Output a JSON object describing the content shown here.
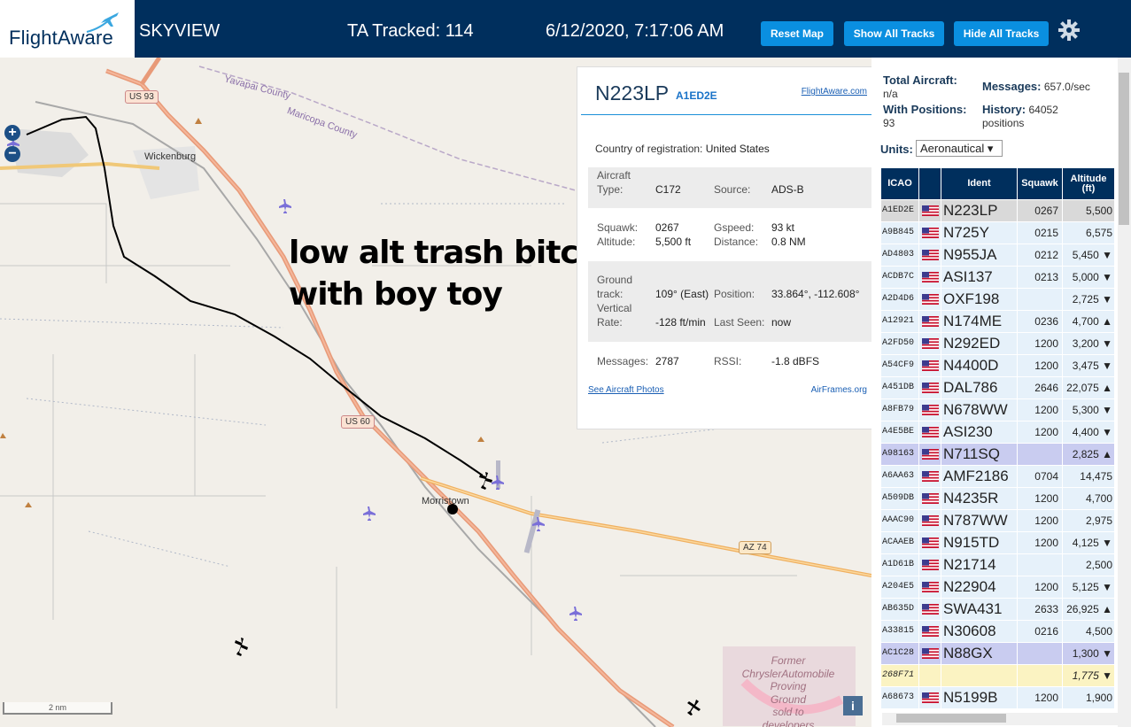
{
  "header": {
    "logo_text": "FlightAware",
    "app_title": "SKYVIEW",
    "tracked": "TA Tracked: 114",
    "datetime": "6/12/2020, 7:17:06 AM",
    "btn_reset": "Reset Map",
    "btn_show": "Show All Tracks",
    "btn_hide": "Hide All Tracks",
    "settings_icon": "gear-icon"
  },
  "map": {
    "zoom_in": "+",
    "zoom_out": "−",
    "annotation_line1": "low alt trash bitch",
    "annotation_line2": "with boy toy",
    "labels": {
      "yavapai": "Yavapai County",
      "maricopa": "Maricopa County",
      "wickenburg": "Wickenburg",
      "morristown": "Morristown",
      "us93": "US 93",
      "us60": "US 60",
      "az74": "AZ 74",
      "former1": "Former",
      "former2": "ChryslerAutomobile",
      "former3": "Proving",
      "former4": "Ground",
      "former5": "sold to",
      "former6": "developers"
    },
    "scale": "2 nm",
    "info": "i"
  },
  "detail": {
    "callsign": "N223LP",
    "hex": "A1ED2E",
    "fa_link": "FlightAware.com",
    "country_label": "Country of registration:",
    "country": "United States",
    "type_label1": "Aircraft",
    "type_label2": "Type:",
    "type": "C172",
    "source_label": "Source:",
    "source": "ADS-B",
    "squawk_label": "Squawk:",
    "squawk": "0267",
    "gspeed_label": "Gspeed:",
    "gspeed": "93 kt",
    "altitude_label": "Altitude:",
    "altitude": "5,500 ft",
    "distance_label": "Distance:",
    "distance": "0.8 NM",
    "track_label1": "Ground",
    "track_label2": "track:",
    "track": "109° (East)",
    "position_label": "Position:",
    "position": "33.864°, -112.608°",
    "vrate_label1": "Vertical",
    "vrate_label2": "Rate:",
    "vrate": "-128 ft/min",
    "lastseen_label": "Last Seen:",
    "lastseen": "now",
    "messages_label": "Messages:",
    "messages": "2787",
    "rssi_label": "RSSI:",
    "rssi": "-1.8 dBFS",
    "photos_link": "See Aircraft Photos",
    "airframes_link": "AirFrames.org"
  },
  "sidebar": {
    "total_label": "Total Aircraft:",
    "total": "n/a",
    "messages_label": "Messages:",
    "messages": "657.0/sec",
    "withpos_label": "With Positions:",
    "withpos": "93",
    "history_label": "History:",
    "history": "64052",
    "history_unit": "positions",
    "units_label": "Units:",
    "units_value": "Aeronautical ▾",
    "columns": {
      "icao": "ICAO",
      "flag": "",
      "ident": "Ident",
      "squawk": "Squawk",
      "alt1": "Altitude",
      "alt2": "(ft)"
    },
    "rows": [
      {
        "icao": "A1ED2E",
        "ident": "N223LP",
        "squawk": "0267",
        "alt": "5,500",
        "style": "selected"
      },
      {
        "icao": "A9B845",
        "ident": "N725Y",
        "squawk": "0215",
        "alt": "6,575",
        "style": "normal"
      },
      {
        "icao": "AD4803",
        "ident": "N955JA",
        "squawk": "0212",
        "alt": "5,450 ▼",
        "style": "normal"
      },
      {
        "icao": "ACDB7C",
        "ident": "ASI137",
        "squawk": "0213",
        "alt": "5,000 ▼",
        "style": "normal"
      },
      {
        "icao": "A2D4D6",
        "ident": "OXF198",
        "squawk": "",
        "alt": "2,725 ▼",
        "style": "normal"
      },
      {
        "icao": "A12921",
        "ident": "N174ME",
        "squawk": "0236",
        "alt": "4,700 ▲",
        "style": "normal"
      },
      {
        "icao": "A2FD50",
        "ident": "N292ED",
        "squawk": "1200",
        "alt": "3,200 ▼",
        "style": "normal"
      },
      {
        "icao": "A54CF9",
        "ident": "N4400D",
        "squawk": "1200",
        "alt": "3,475 ▼",
        "style": "normal"
      },
      {
        "icao": "A451DB",
        "ident": "DAL786",
        "squawk": "2646",
        "alt": "22,075 ▲",
        "style": "normal"
      },
      {
        "icao": "A8FB79",
        "ident": "N678WW",
        "squawk": "1200",
        "alt": "5,300 ▼",
        "style": "normal"
      },
      {
        "icao": "A4E5BE",
        "ident": "ASI230",
        "squawk": "1200",
        "alt": "4,400 ▼",
        "style": "normal"
      },
      {
        "icao": "A98163",
        "ident": "N711SQ",
        "squawk": "",
        "alt": "2,825 ▲",
        "style": "purple"
      },
      {
        "icao": "A6AA63",
        "ident": "AMF2186",
        "squawk": "0704",
        "alt": "14,475",
        "style": "normal"
      },
      {
        "icao": "A509DB",
        "ident": "N4235R",
        "squawk": "1200",
        "alt": "4,700",
        "style": "normal"
      },
      {
        "icao": "AAAC90",
        "ident": "N787WW",
        "squawk": "1200",
        "alt": "2,975",
        "style": "normal"
      },
      {
        "icao": "ACAAEB",
        "ident": "N915TD",
        "squawk": "1200",
        "alt": "4,125 ▼",
        "style": "normal"
      },
      {
        "icao": "A1D61B",
        "ident": "N21714",
        "squawk": "",
        "alt": "2,500",
        "style": "normal"
      },
      {
        "icao": "A204E5",
        "ident": "N22904",
        "squawk": "1200",
        "alt": "5,125 ▼",
        "style": "normal"
      },
      {
        "icao": "AB635D",
        "ident": "SWA431",
        "squawk": "2633",
        "alt": "26,925 ▲",
        "style": "normal"
      },
      {
        "icao": "A33815",
        "ident": "N30608",
        "squawk": "0216",
        "alt": "4,500",
        "style": "normal"
      },
      {
        "icao": "AC1C28",
        "ident": "N88GX",
        "squawk": "",
        "alt": "1,300 ▼",
        "style": "purple"
      },
      {
        "icao": "268F71",
        "ident": "",
        "squawk": "",
        "alt": "1,775 ▼",
        "style": "yellow"
      },
      {
        "icao": "A68673",
        "ident": "N5199B",
        "squawk": "1200",
        "alt": "1,900",
        "style": "normal"
      }
    ]
  },
  "colors": {
    "header_bg": "#002f5d",
    "button": "#0a8fe0",
    "row_normal": "#e6f1fa",
    "row_selected": "#d9d9d9",
    "row_purple": "#c9ccf0",
    "row_yellow": "#fbf3c2"
  }
}
